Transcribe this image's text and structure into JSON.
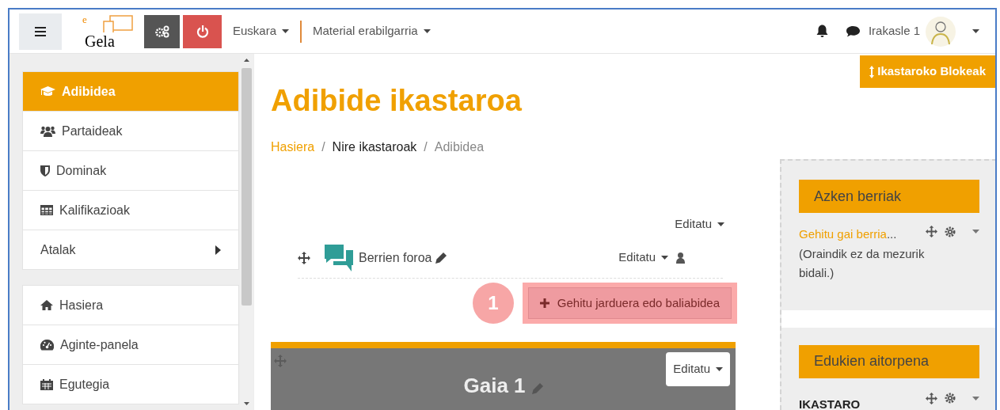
{
  "navbar": {
    "logo": {
      "letter": "e",
      "word": "Gela"
    },
    "menus": [
      {
        "label": "Euskara"
      },
      {
        "label": "Material erabilgarria"
      }
    ],
    "user": "Irakasle 1"
  },
  "blocks_button": "Ikastaroko Blokeak",
  "sidebar": {
    "groups": [
      [
        {
          "label": "Adibidea",
          "selected": true,
          "submenu": false
        },
        {
          "label": "Partaideak",
          "selected": false,
          "submenu": false
        },
        {
          "label": "Dominak",
          "selected": false,
          "submenu": false
        },
        {
          "label": "Kalifikazioak",
          "selected": false,
          "submenu": false
        },
        {
          "label": "Atalak",
          "selected": false,
          "submenu": true
        }
      ],
      [
        {
          "label": "Hasiera",
          "selected": false,
          "submenu": false
        },
        {
          "label": "Aginte-panela",
          "selected": false,
          "submenu": false
        },
        {
          "label": "Egutegia",
          "selected": false,
          "submenu": false
        }
      ]
    ]
  },
  "course": {
    "title": "Adibide ikastaroa",
    "separator": "/",
    "breadcrumb": [
      {
        "label": "Hasiera",
        "kind": "link"
      },
      {
        "label": "Nire ikastaroak",
        "kind": "plain"
      },
      {
        "label": "Adibidea",
        "kind": "current"
      }
    ]
  },
  "section0": {
    "edit": "Editatu",
    "activity": {
      "name": "Berrien foroa",
      "edit": "Editatu"
    },
    "add_button": "Gehitu jarduera edo baliabidea",
    "annotation": "1"
  },
  "section1": {
    "title": "Gaia 1",
    "edit": "Editatu"
  },
  "blocks": [
    {
      "title": "Azken berriak",
      "link": "Gehitu gai berria",
      "link_suffix": "...",
      "text": "(Oraindik ez da mezurik bidali.)"
    },
    {
      "title": "Edukien aitorpena",
      "heading": "IKASTARO"
    }
  ]
}
